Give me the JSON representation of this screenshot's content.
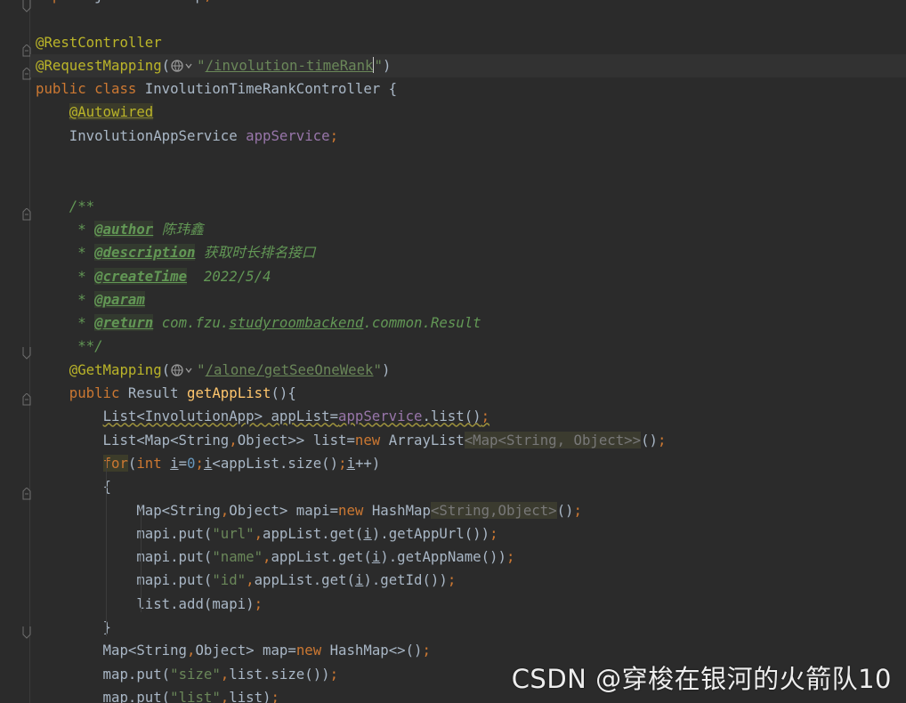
{
  "watermark": "CSDN @穿梭在银河的火箭队10",
  "lines": [
    [
      {
        "t": "import",
        "c": "kw"
      },
      {
        "t": " java.util.Map",
        "c": "plain"
      },
      {
        "t": ";",
        "c": "punct"
      }
    ],
    [],
    [
      {
        "t": "@RestController",
        "c": "ann"
      }
    ],
    [
      {
        "t": "@RequestMapping",
        "c": "ann"
      },
      {
        "t": "(",
        "c": "plain"
      },
      {
        "globe": true
      },
      {
        "t": "\"",
        "c": "str"
      },
      {
        "t": "/involution-timeRank",
        "c": "url"
      },
      {
        "caret": true
      },
      {
        "t": "\"",
        "c": "str"
      },
      {
        "t": ")",
        "c": "plain"
      }
    ],
    [
      {
        "t": "public class ",
        "c": "kw"
      },
      {
        "t": "InvolutionTimeRankController {",
        "c": "plain"
      }
    ],
    [
      {
        "t": "    ",
        "c": "plain"
      },
      {
        "t": "@Autowired",
        "c": "ann-hl"
      }
    ],
    [
      {
        "t": "    InvolutionAppService ",
        "c": "plain"
      },
      {
        "t": "appService",
        "c": "field"
      },
      {
        "t": ";",
        "c": "punct"
      }
    ],
    [],
    [],
    [
      {
        "t": "    /**",
        "c": "doc"
      }
    ],
    [
      {
        "t": "     * ",
        "c": "doc"
      },
      {
        "t": "@author",
        "c": "doctag"
      },
      {
        "t": " 陈玮鑫",
        "c": "doctext"
      }
    ],
    [
      {
        "t": "     * ",
        "c": "doc"
      },
      {
        "t": "@description",
        "c": "doctag"
      },
      {
        "t": " 获取时长排名接口",
        "c": "doctext"
      }
    ],
    [
      {
        "t": "     * ",
        "c": "doc"
      },
      {
        "t": "@createTime",
        "c": "doctag"
      },
      {
        "t": "  2022/5/4",
        "c": "doctext"
      }
    ],
    [
      {
        "t": "     * ",
        "c": "doc"
      },
      {
        "t": "@param",
        "c": "doctag"
      }
    ],
    [
      {
        "t": "     * ",
        "c": "doc"
      },
      {
        "t": "@return",
        "c": "doctag"
      },
      {
        "t": " com.fzu.",
        "c": "doctext"
      },
      {
        "t": "studyroombackend",
        "c": "docref"
      },
      {
        "t": ".common.Result",
        "c": "doctext"
      }
    ],
    [
      {
        "t": "     **/",
        "c": "doc"
      }
    ],
    [
      {
        "t": "    ",
        "c": "plain"
      },
      {
        "t": "@GetMapping",
        "c": "ann"
      },
      {
        "t": "(",
        "c": "plain"
      },
      {
        "globe": true
      },
      {
        "t": "\"",
        "c": "str"
      },
      {
        "t": "/alone/getSeeOneWeek",
        "c": "url"
      },
      {
        "t": "\"",
        "c": "str"
      },
      {
        "t": ")",
        "c": "plain"
      }
    ],
    [
      {
        "t": "    ",
        "c": "plain"
      },
      {
        "t": "public ",
        "c": "kw"
      },
      {
        "t": "Result ",
        "c": "plain"
      },
      {
        "t": "getAppList",
        "c": "method"
      },
      {
        "t": "(){",
        "c": "plain"
      }
    ],
    [
      {
        "t": "        ",
        "c": "plain"
      },
      {
        "t": "List<InvolutionApp> appList=",
        "c": "plain wavy"
      },
      {
        "t": "appService",
        "c": "field wavy"
      },
      {
        "t": ".list()",
        "c": "plain wavy"
      },
      {
        "t": ";",
        "c": "punct wavy"
      }
    ],
    [
      {
        "t": "        List<Map<String",
        "c": "plain"
      },
      {
        "t": ",",
        "c": "punct"
      },
      {
        "t": "Object>> list=",
        "c": "plain"
      },
      {
        "t": "new ",
        "c": "kw"
      },
      {
        "t": "ArrayList",
        "c": "plain"
      },
      {
        "t": "<Map<String, Object>>",
        "c": "hint"
      },
      {
        "t": "()",
        "c": "plain"
      },
      {
        "t": ";",
        "c": "punct"
      }
    ],
    [
      {
        "t": "        ",
        "c": "plain"
      },
      {
        "t": "for",
        "c": "kw-hl"
      },
      {
        "t": "(",
        "c": "plain"
      },
      {
        "t": "int ",
        "c": "kw"
      },
      {
        "t": "i",
        "c": "plain under"
      },
      {
        "t": "=",
        "c": "plain"
      },
      {
        "t": "0",
        "c": "num"
      },
      {
        "t": ";",
        "c": "punct"
      },
      {
        "t": "i",
        "c": "plain under"
      },
      {
        "t": "<appList.size()",
        "c": "plain"
      },
      {
        "t": ";",
        "c": "punct"
      },
      {
        "t": "i",
        "c": "plain under"
      },
      {
        "t": "++)",
        "c": "plain"
      }
    ],
    [
      {
        "t": "        {",
        "c": "plain"
      }
    ],
    [
      {
        "t": "            Map<String",
        "c": "plain"
      },
      {
        "t": ",",
        "c": "punct"
      },
      {
        "t": "Object> mapi=",
        "c": "plain"
      },
      {
        "t": "new ",
        "c": "kw"
      },
      {
        "t": "HashMap",
        "c": "plain"
      },
      {
        "t": "<String,Object>",
        "c": "hint"
      },
      {
        "t": "()",
        "c": "plain"
      },
      {
        "t": ";",
        "c": "punct"
      }
    ],
    [
      {
        "t": "            mapi.put(",
        "c": "plain"
      },
      {
        "t": "\"url\"",
        "c": "str"
      },
      {
        "t": ",",
        "c": "punct"
      },
      {
        "t": "appList.get(",
        "c": "plain"
      },
      {
        "t": "i",
        "c": "plain under"
      },
      {
        "t": ").getAppUrl())",
        "c": "plain"
      },
      {
        "t": ";",
        "c": "punct"
      }
    ],
    [
      {
        "t": "            mapi.put(",
        "c": "plain"
      },
      {
        "t": "\"name\"",
        "c": "str"
      },
      {
        "t": ",",
        "c": "punct"
      },
      {
        "t": "appList.get(",
        "c": "plain"
      },
      {
        "t": "i",
        "c": "plain under"
      },
      {
        "t": ").getAppName())",
        "c": "plain"
      },
      {
        "t": ";",
        "c": "punct"
      }
    ],
    [
      {
        "t": "            mapi.put(",
        "c": "plain"
      },
      {
        "t": "\"id\"",
        "c": "str"
      },
      {
        "t": ",",
        "c": "punct"
      },
      {
        "t": "appList.get(",
        "c": "plain"
      },
      {
        "t": "i",
        "c": "plain under"
      },
      {
        "t": ").getId())",
        "c": "plain"
      },
      {
        "t": ";",
        "c": "punct"
      }
    ],
    [
      {
        "t": "            list.add(mapi)",
        "c": "plain"
      },
      {
        "t": ";",
        "c": "punct"
      }
    ],
    [
      {
        "t": "        }",
        "c": "plain"
      }
    ],
    [
      {
        "t": "        Map<String",
        "c": "plain"
      },
      {
        "t": ",",
        "c": "punct"
      },
      {
        "t": "Object> map=",
        "c": "plain"
      },
      {
        "t": "new ",
        "c": "kw"
      },
      {
        "t": "HashMap<>()",
        "c": "plain"
      },
      {
        "t": ";",
        "c": "punct"
      }
    ],
    [
      {
        "t": "        map.put(",
        "c": "plain"
      },
      {
        "t": "\"size\"",
        "c": "str"
      },
      {
        "t": ",",
        "c": "punct"
      },
      {
        "t": "list.size())",
        "c": "plain"
      },
      {
        "t": ";",
        "c": "punct"
      }
    ],
    [
      {
        "t": "        map.put(",
        "c": "plain"
      },
      {
        "t": "\"list\"",
        "c": "str"
      },
      {
        "t": ",",
        "c": "punct"
      },
      {
        "t": "list)",
        "c": "plain"
      },
      {
        "t": ";",
        "c": "punct"
      }
    ]
  ]
}
